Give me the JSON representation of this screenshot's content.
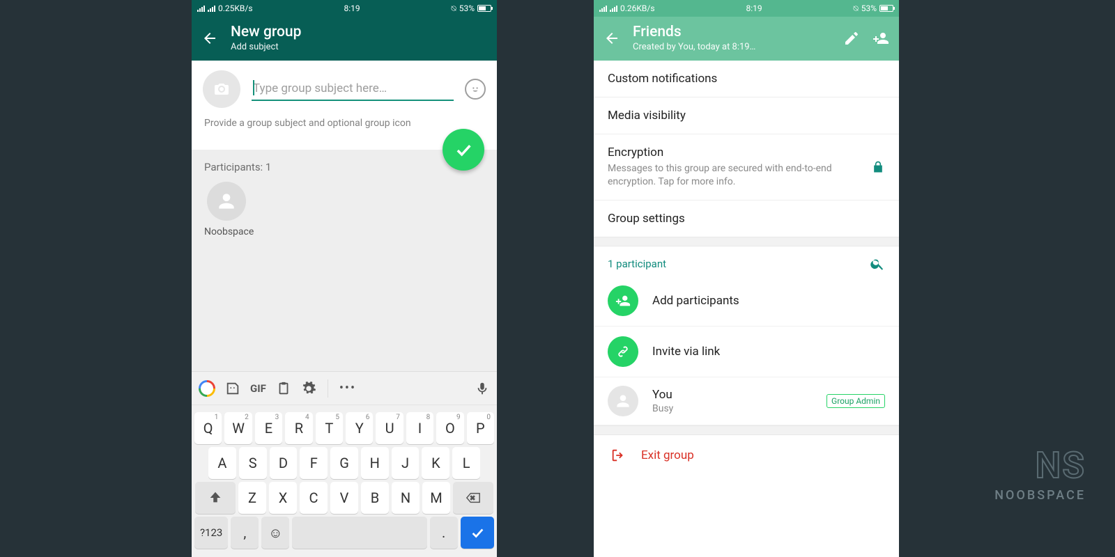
{
  "watermark": {
    "logo": "NS",
    "label": "NOOBSPACE"
  },
  "screen1": {
    "status": {
      "net": "0.25KB/s",
      "time": "8:19",
      "battery": "53%"
    },
    "appbar": {
      "title": "New group",
      "subtitle": "Add subject"
    },
    "subject": {
      "placeholder": "Type group subject here…"
    },
    "hint": "Provide a group subject and optional group icon",
    "participants": {
      "label": "Participants: 1",
      "items": [
        {
          "name": "Noobspace"
        }
      ]
    },
    "keyboard": {
      "gif": "GIF",
      "row1": [
        "Q",
        "W",
        "E",
        "R",
        "T",
        "Y",
        "U",
        "I",
        "O",
        "P"
      ],
      "row1n": [
        "1",
        "2",
        "3",
        "4",
        "5",
        "6",
        "7",
        "8",
        "9",
        "0"
      ],
      "row2": [
        "A",
        "S",
        "D",
        "F",
        "G",
        "H",
        "J",
        "K",
        "L"
      ],
      "row3": [
        "Z",
        "X",
        "C",
        "V",
        "B",
        "N",
        "M"
      ],
      "sym": "?123",
      "comma": ",",
      "period": "."
    }
  },
  "screen2": {
    "status": {
      "net": "0.26KB/s",
      "time": "8:19",
      "battery": "53%"
    },
    "appbar": {
      "title": "Friends",
      "subtitle": "Created by You, today at 8:19…"
    },
    "items": {
      "custom": "Custom notifications",
      "media": "Media visibility",
      "enc_title": "Encryption",
      "enc_sub": "Messages to this group are secured with end-to-end encryption. Tap for more info.",
      "settings": "Group settings"
    },
    "participants": {
      "header": "1 participant",
      "add": "Add participants",
      "invite": "Invite via link",
      "you": {
        "name": "You",
        "status": "Busy",
        "badge": "Group Admin"
      }
    },
    "exit": "Exit group"
  }
}
